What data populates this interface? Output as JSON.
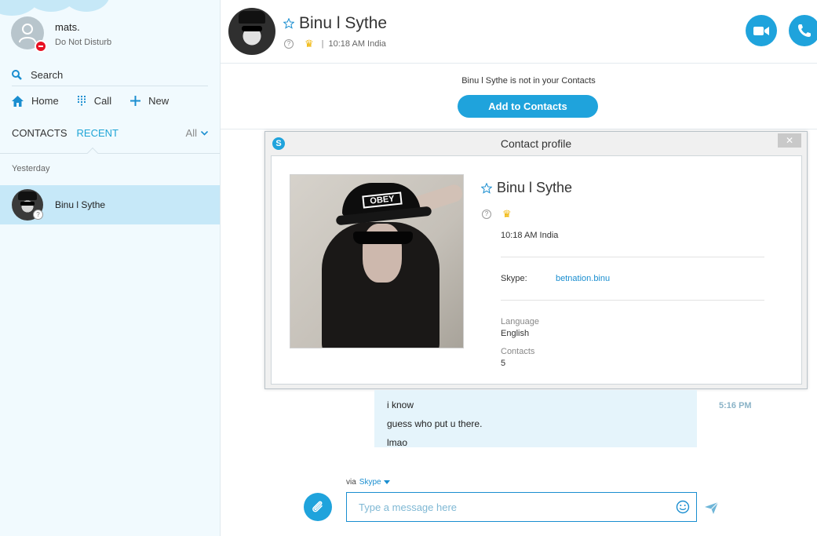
{
  "sidebar": {
    "user": {
      "name": "mats.",
      "status": "Do Not Disturb"
    },
    "search_label": "Search",
    "nav": [
      {
        "label": "Home",
        "icon": "home-icon"
      },
      {
        "label": "Call",
        "icon": "dialpad-icon"
      },
      {
        "label": "New",
        "icon": "plus-icon"
      }
    ],
    "tabs": {
      "contacts": "CONTACTS",
      "recent": "RECENT",
      "filter": "All"
    },
    "group_label": "Yesterday",
    "recent": [
      {
        "name": "Binu l Sythe",
        "status": "unknown"
      }
    ]
  },
  "header": {
    "name": "Binu l Sythe",
    "time": "10:18 AM India",
    "separator": "|"
  },
  "banner": {
    "text": "Binu l Sythe is not in your Contacts",
    "button": "Add to Contacts"
  },
  "profile_dialog": {
    "title": "Contact profile",
    "close_glyph": "✕",
    "photo_cap_text": "OBEY",
    "name": "Binu l Sythe",
    "time": "10:18 AM India",
    "skype_label": "Skype:",
    "skype_value": "betnation.binu",
    "language_label": "Language",
    "language_value": "English",
    "contacts_label": "Contacts",
    "contacts_value": "5"
  },
  "messages": {
    "lines": [
      "i know",
      "guess who put u there.",
      "lmao"
    ],
    "time": "5:16 PM"
  },
  "composer": {
    "via_label": "via",
    "via_service": "Skype",
    "placeholder": "Type a message here"
  },
  "colors": {
    "accent": "#1fa3dc",
    "sidebar_bg": "#f1fafe",
    "selected_row": "#c6e8f8",
    "bubble": "#e5f4fb",
    "dnd": "#e81123"
  }
}
